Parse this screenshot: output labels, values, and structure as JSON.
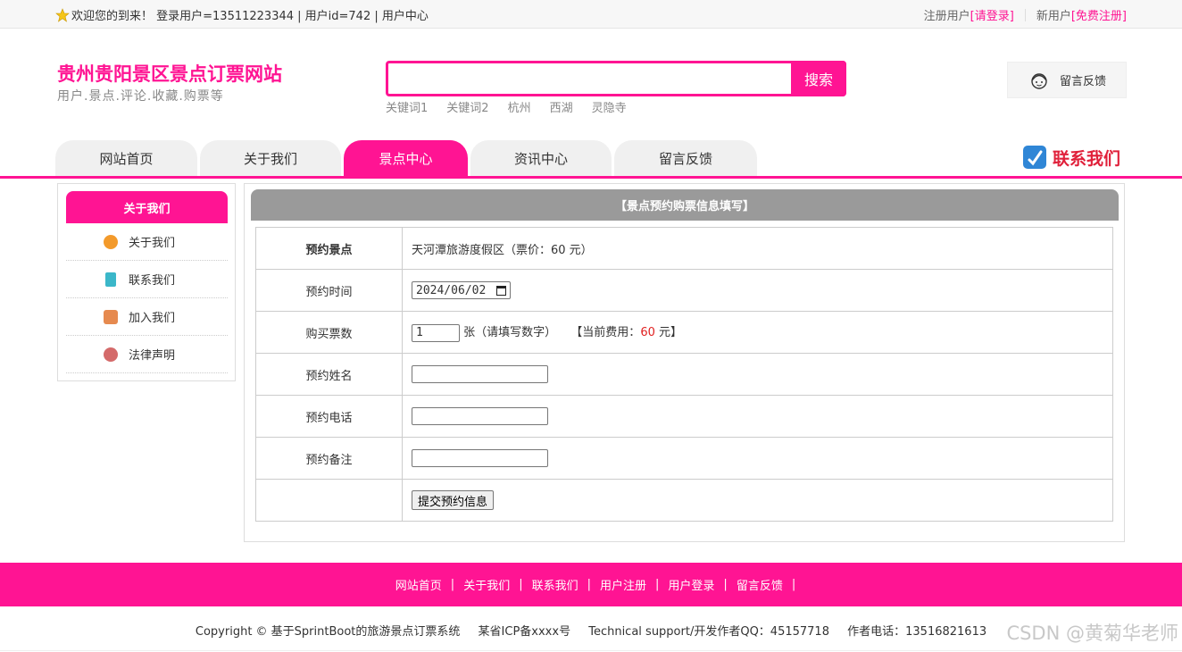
{
  "topbar": {
    "welcome": "欢迎您的到来！ 登录用户=13511223344 | 用户id=742 | 用户中心",
    "register_user": "注册用户",
    "login_link": "[请登录]",
    "new_user": "新用户",
    "free_register": "[免费注册]"
  },
  "header": {
    "title": "贵州贵阳景区景点订票网站",
    "subtitle": "用户.景点.评论.收藏.购票等",
    "search_button": "搜索",
    "search_value": "",
    "keywords": [
      "关键词1",
      "关键词2",
      "杭州",
      "西湖",
      "灵隐寺"
    ],
    "feedback": "留言反馈",
    "contact": "联系我们"
  },
  "nav": {
    "tabs": [
      {
        "label": "网站首页"
      },
      {
        "label": "关于我们"
      },
      {
        "label": "景点中心"
      },
      {
        "label": "资讯中心"
      },
      {
        "label": "留言反馈"
      }
    ],
    "active": "景点中心"
  },
  "sidebar": {
    "title": "关于我们",
    "items": [
      {
        "label": "关于我们",
        "icon": "orange-circle-icon",
        "color": "#f39a2b"
      },
      {
        "label": "联系我们",
        "icon": "clipboard-icon",
        "color": "#3bb7c9"
      },
      {
        "label": "加入我们",
        "icon": "lock-icon",
        "color": "#e68a4f"
      },
      {
        "label": "法律声明",
        "icon": "power-icon",
        "color": "#d46a6a"
      }
    ]
  },
  "main": {
    "title": "【景点预约购票信息填写】",
    "rows": {
      "spot_label": "预约景点",
      "spot_value": "天河潭旅游度假区（票价：60 元）",
      "time_label": "预约时间",
      "time_value": "2024/06/02",
      "count_label": "购买票数",
      "count_value": "1",
      "count_unit": "张（请填写数字）",
      "fee_prefix": "【当前费用：",
      "fee_value": "60",
      "fee_suffix": " 元】",
      "name_label": "预约姓名",
      "phone_label": "预约电话",
      "note_label": "预约备注",
      "submit": "提交预约信息"
    }
  },
  "footer": {
    "links": [
      "网站首页",
      "关于我们",
      "联系我们",
      "用户注册",
      "用户登录",
      "留言反馈"
    ],
    "copyright": "Copyright © 基于SprintBoot的旅游景点订票系统",
    "icp": "某省ICP备xxxx号",
    "support": "Technical support/开发作者QQ：45157718",
    "phone": "作者电话：13516821613"
  },
  "watermark": "CSDN @黄菊华老师",
  "colors": {
    "accent": "#ff1493",
    "header_gray": "#9a9a9a",
    "price_red": "#e02020"
  }
}
